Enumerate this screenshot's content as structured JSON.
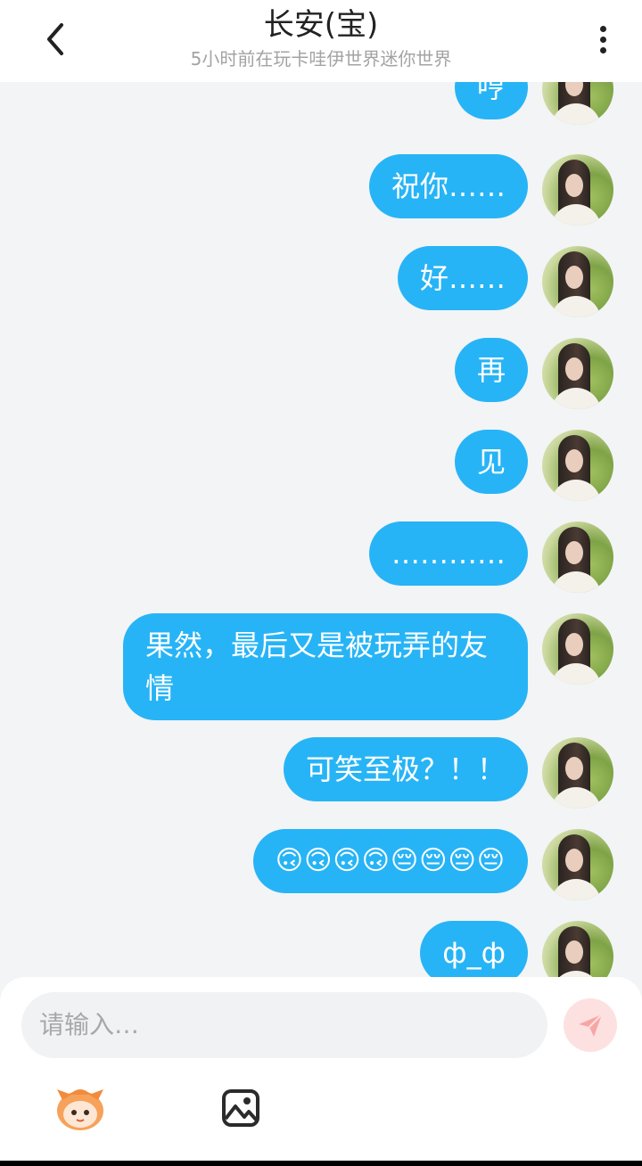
{
  "header": {
    "back_icon": "chevron-left-icon",
    "title": "长安(宝)",
    "subtitle": "5小时前在玩卡哇伊世界迷你世界",
    "more_icon": "more-vertical-icon"
  },
  "messages": [
    {
      "text": "哼"
    },
    {
      "text": "祝你……"
    },
    {
      "text": "好……"
    },
    {
      "text": "再"
    },
    {
      "text": "见"
    },
    {
      "text": "…………"
    },
    {
      "text": "果然，最后又是被玩弄的友情"
    },
    {
      "text": "可笑至极？！！"
    },
    {
      "text": "🙃🙃🙃🙃😔😔😔😔"
    },
    {
      "text": "ф_ф"
    }
  ],
  "input": {
    "placeholder": "请输入…",
    "send_icon": "send-icon"
  },
  "toolbar": {
    "sticker_icon": "mascot-sticker-icon",
    "image_icon": "image-icon"
  },
  "colors": {
    "bubble": "#27b4f6",
    "send_button_bg": "#fde1e1",
    "send_icon": "#f7a6a6"
  }
}
